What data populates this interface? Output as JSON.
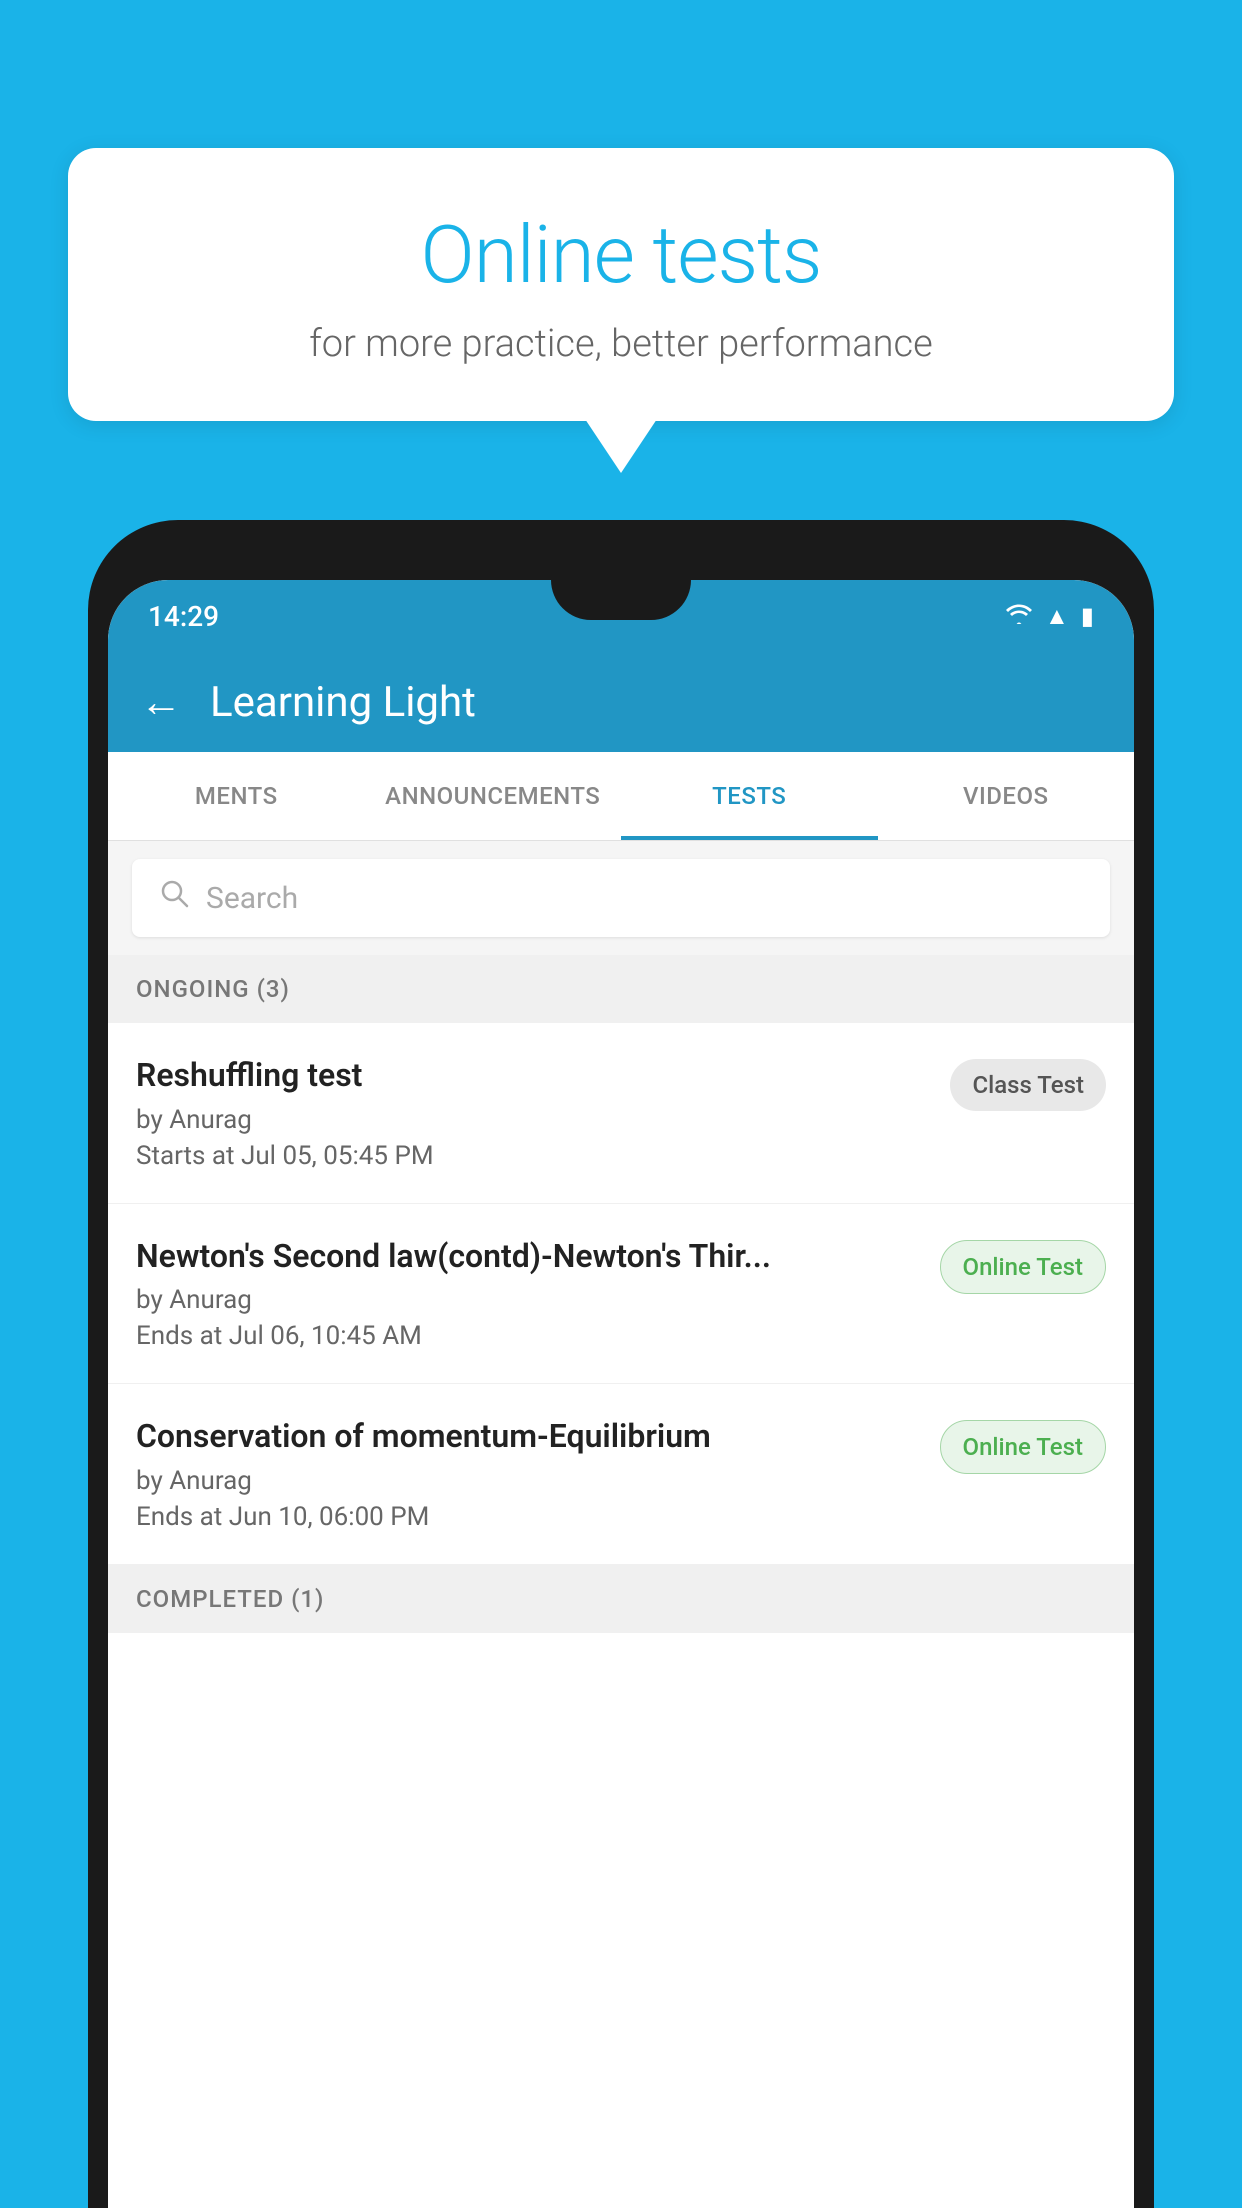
{
  "background_color": "#1ab3e8",
  "bubble": {
    "title": "Online tests",
    "subtitle": "for more practice, better performance"
  },
  "phone": {
    "status_bar": {
      "time": "14:29",
      "icons": [
        "wifi",
        "signal",
        "battery"
      ]
    },
    "app_bar": {
      "back_label": "←",
      "title": "Learning Light"
    },
    "tabs": [
      {
        "label": "MENTS",
        "active": false
      },
      {
        "label": "ANNOUNCEMENTS",
        "active": false
      },
      {
        "label": "TESTS",
        "active": true
      },
      {
        "label": "VIDEOS",
        "active": false
      }
    ],
    "search": {
      "placeholder": "Search"
    },
    "ongoing_section": {
      "header": "ONGOING (3)"
    },
    "tests": [
      {
        "name": "Reshuffling test",
        "author": "by Anurag",
        "date": "Starts at  Jul 05, 05:45 PM",
        "badge": "Class Test",
        "badge_type": "class"
      },
      {
        "name": "Newton's Second law(contd)-Newton's Thir...",
        "author": "by Anurag",
        "date": "Ends at  Jul 06, 10:45 AM",
        "badge": "Online Test",
        "badge_type": "online"
      },
      {
        "name": "Conservation of momentum-Equilibrium",
        "author": "by Anurag",
        "date": "Ends at  Jun 10, 06:00 PM",
        "badge": "Online Test",
        "badge_type": "online"
      }
    ],
    "completed_section": {
      "header": "COMPLETED (1)"
    }
  }
}
